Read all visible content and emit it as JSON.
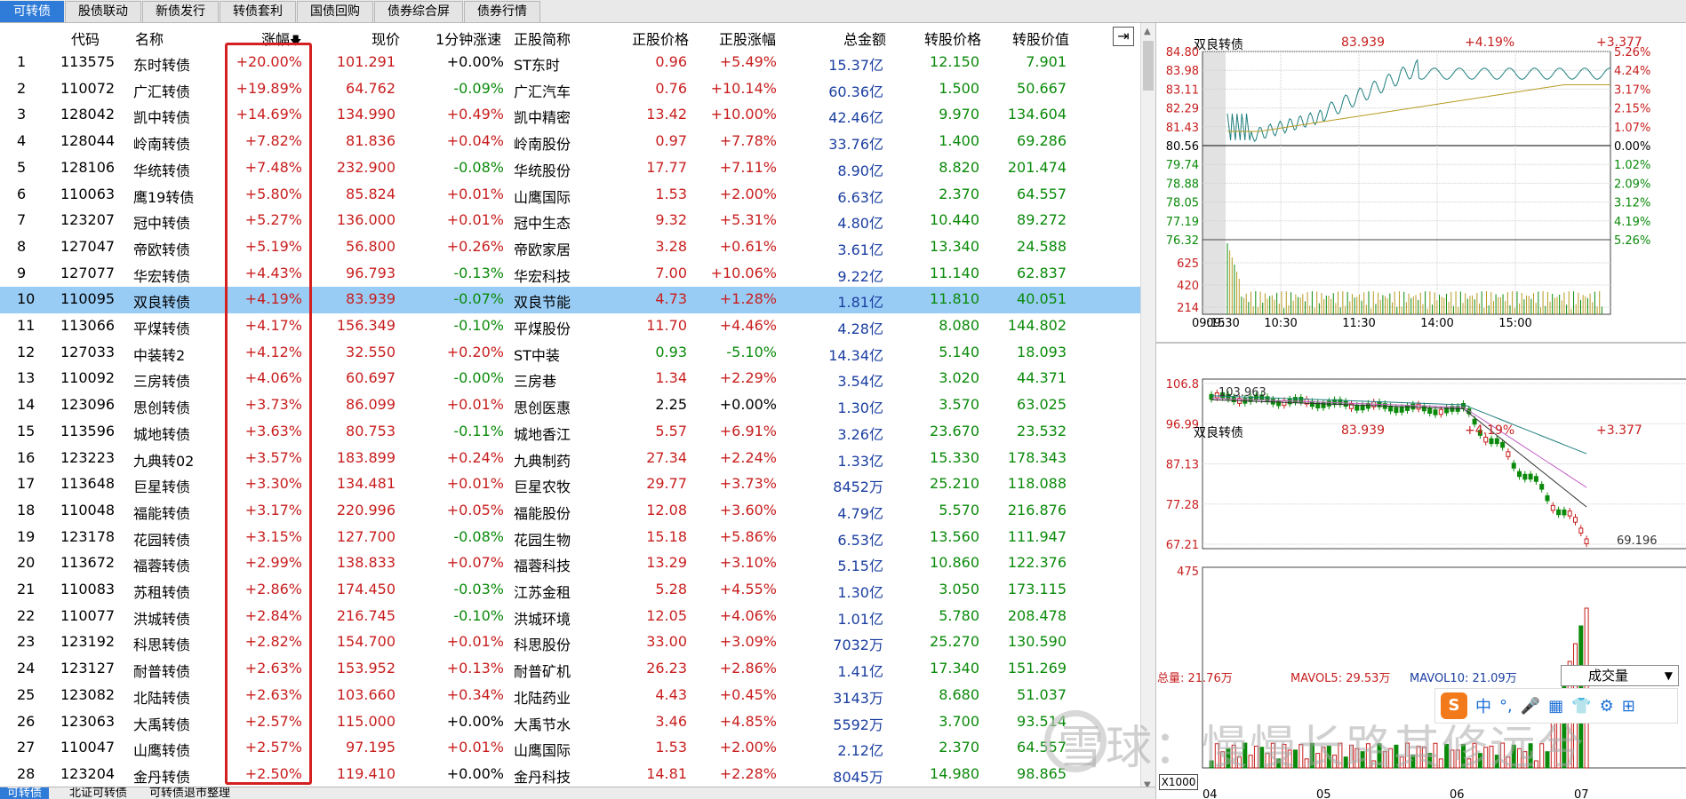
{
  "top_tabs": [
    "可转债",
    "股债联动",
    "新债发行",
    "转债套利",
    "国债回购",
    "债券综合屏",
    "债券行情"
  ],
  "headers": {
    "code": "代码",
    "name": "名称",
    "change": "涨幅",
    "price": "现价",
    "speed": "1分钟涨速",
    "stock_name": "正股简称",
    "stock_price": "正股价格",
    "stock_change": "正股涨幅",
    "total": "总金额",
    "conv_price": "转股价格",
    "conv_value": "转股价值"
  },
  "rows": [
    {
      "idx": "1",
      "code": "113575",
      "name": "东时转债",
      "change": "+20.00%",
      "price": "101.291",
      "speed": "+0.00%",
      "stock": "ST东时",
      "sp": "0.96",
      "sc": "+5.49%",
      "total": "15.37亿",
      "cp": "12.150",
      "cv": "7.901",
      "sp_color": "red",
      "speed_color": "black"
    },
    {
      "idx": "2",
      "code": "110072",
      "name": "广汇转债",
      "change": "+19.89%",
      "price": "64.762",
      "speed": "-0.09%",
      "stock": "广汇汽车",
      "sp": "0.76",
      "sc": "+10.14%",
      "total": "60.36亿",
      "cp": "1.500",
      "cv": "50.667",
      "sp_color": "red",
      "speed_color": "green"
    },
    {
      "idx": "3",
      "code": "128042",
      "name": "凯中转债",
      "change": "+14.69%",
      "price": "134.990",
      "speed": "+0.49%",
      "stock": "凯中精密",
      "sp": "13.42",
      "sc": "+10.00%",
      "total": "42.46亿",
      "cp": "9.970",
      "cv": "134.604",
      "sp_color": "red",
      "speed_color": "red"
    },
    {
      "idx": "4",
      "code": "128044",
      "name": "岭南转债",
      "change": "+7.82%",
      "price": "81.836",
      "speed": "+0.04%",
      "stock": "岭南股份",
      "sp": "0.97",
      "sc": "+7.78%",
      "total": "33.76亿",
      "cp": "1.400",
      "cv": "69.286",
      "sp_color": "red",
      "speed_color": "red"
    },
    {
      "idx": "5",
      "code": "128106",
      "name": "华统转债",
      "change": "+7.48%",
      "price": "232.900",
      "speed": "-0.08%",
      "stock": "华统股份",
      "sp": "17.77",
      "sc": "+7.11%",
      "total": "8.90亿",
      "cp": "8.820",
      "cv": "201.474",
      "sp_color": "red",
      "speed_color": "green"
    },
    {
      "idx": "6",
      "code": "110063",
      "name": "鹰19转债",
      "change": "+5.80%",
      "price": "85.824",
      "speed": "+0.01%",
      "stock": "山鹰国际",
      "sp": "1.53",
      "sc": "+2.00%",
      "total": "6.63亿",
      "cp": "2.370",
      "cv": "64.557",
      "sp_color": "red",
      "speed_color": "red"
    },
    {
      "idx": "7",
      "code": "123207",
      "name": "冠中转债",
      "change": "+5.27%",
      "price": "136.000",
      "speed": "+0.01%",
      "stock": "冠中生态",
      "sp": "9.32",
      "sc": "+5.31%",
      "total": "4.80亿",
      "cp": "10.440",
      "cv": "89.272",
      "sp_color": "red",
      "speed_color": "red"
    },
    {
      "idx": "8",
      "code": "127047",
      "name": "帝欧转债",
      "change": "+5.19%",
      "price": "56.800",
      "speed": "+0.26%",
      "stock": "帝欧家居",
      "sp": "3.28",
      "sc": "+0.61%",
      "total": "3.61亿",
      "cp": "13.340",
      "cv": "24.588",
      "sp_color": "red",
      "speed_color": "red"
    },
    {
      "idx": "9",
      "code": "127077",
      "name": "华宏转债",
      "change": "+4.43%",
      "price": "96.793",
      "speed": "-0.13%",
      "stock": "华宏科技",
      "sp": "7.00",
      "sc": "+10.06%",
      "total": "9.22亿",
      "cp": "11.140",
      "cv": "62.837",
      "sp_color": "red",
      "speed_color": "green"
    },
    {
      "idx": "10",
      "code": "110095",
      "name": "双良转债",
      "change": "+4.19%",
      "price": "83.939",
      "speed": "-0.07%",
      "stock": "双良节能",
      "sp": "4.73",
      "sc": "+1.28%",
      "total": "1.81亿",
      "cp": "11.810",
      "cv": "40.051",
      "sp_color": "red",
      "speed_color": "green",
      "selected": true
    },
    {
      "idx": "11",
      "code": "113066",
      "name": "平煤转债",
      "change": "+4.17%",
      "price": "156.349",
      "speed": "-0.10%",
      "stock": "平煤股份",
      "sp": "11.70",
      "sc": "+4.46%",
      "total": "4.28亿",
      "cp": "8.080",
      "cv": "144.802",
      "sp_color": "red",
      "speed_color": "green"
    },
    {
      "idx": "12",
      "code": "127033",
      "name": "中装转2",
      "change": "+4.12%",
      "price": "32.550",
      "speed": "+0.20%",
      "stock": "ST中装",
      "sp": "0.93",
      "sc": "-5.10%",
      "total": "14.34亿",
      "cp": "5.140",
      "cv": "18.093",
      "sp_color": "green",
      "speed_color": "red"
    },
    {
      "idx": "13",
      "code": "110092",
      "name": "三房转债",
      "change": "+4.06%",
      "price": "60.697",
      "speed": "-0.00%",
      "stock": "三房巷",
      "sp": "1.34",
      "sc": "+2.29%",
      "total": "3.54亿",
      "cp": "3.020",
      "cv": "44.371",
      "sp_color": "red",
      "speed_color": "green"
    },
    {
      "idx": "14",
      "code": "123096",
      "name": "思创转债",
      "change": "+3.73%",
      "price": "86.099",
      "speed": "+0.01%",
      "stock": "思创医惠",
      "sp": "2.25",
      "sc": "+0.00%",
      "total": "1.30亿",
      "cp": "3.570",
      "cv": "63.025",
      "sp_color": "black",
      "speed_color": "red"
    },
    {
      "idx": "15",
      "code": "113596",
      "name": "城地转债",
      "change": "+3.63%",
      "price": "80.753",
      "speed": "-0.11%",
      "stock": "城地香江",
      "sp": "5.57",
      "sc": "+6.91%",
      "total": "3.26亿",
      "cp": "23.670",
      "cv": "23.532",
      "sp_color": "red",
      "speed_color": "green"
    },
    {
      "idx": "16",
      "code": "123223",
      "name": "九典转02",
      "change": "+3.57%",
      "price": "183.899",
      "speed": "+0.24%",
      "stock": "九典制药",
      "sp": "27.34",
      "sc": "+2.24%",
      "total": "1.33亿",
      "cp": "15.330",
      "cv": "178.343",
      "sp_color": "red",
      "speed_color": "red"
    },
    {
      "idx": "17",
      "code": "113648",
      "name": "巨星转债",
      "change": "+3.30%",
      "price": "134.481",
      "speed": "+0.01%",
      "stock": "巨星农牧",
      "sp": "29.77",
      "sc": "+3.73%",
      "total": "8452万",
      "cp": "25.210",
      "cv": "118.088",
      "sp_color": "red",
      "speed_color": "red"
    },
    {
      "idx": "18",
      "code": "110048",
      "name": "福能转债",
      "change": "+3.17%",
      "price": "220.996",
      "speed": "+0.05%",
      "stock": "福能股份",
      "sp": "12.08",
      "sc": "+3.60%",
      "total": "4.79亿",
      "cp": "5.570",
      "cv": "216.876",
      "sp_color": "red",
      "speed_color": "red"
    },
    {
      "idx": "19",
      "code": "123178",
      "name": "花园转债",
      "change": "+3.15%",
      "price": "127.700",
      "speed": "-0.08%",
      "stock": "花园生物",
      "sp": "15.18",
      "sc": "+5.86%",
      "total": "6.53亿",
      "cp": "13.560",
      "cv": "111.947",
      "sp_color": "red",
      "speed_color": "green"
    },
    {
      "idx": "20",
      "code": "113672",
      "name": "福蓉转债",
      "change": "+2.99%",
      "price": "138.833",
      "speed": "+0.07%",
      "stock": "福蓉科技",
      "sp": "13.29",
      "sc": "+3.10%",
      "total": "5.15亿",
      "cp": "10.860",
      "cv": "122.376",
      "sp_color": "red",
      "speed_color": "red"
    },
    {
      "idx": "21",
      "code": "110083",
      "name": "苏租转债",
      "change": "+2.86%",
      "price": "174.450",
      "speed": "-0.03%",
      "stock": "江苏金租",
      "sp": "5.28",
      "sc": "+4.55%",
      "total": "1.30亿",
      "cp": "3.050",
      "cv": "173.115",
      "sp_color": "red",
      "speed_color": "green"
    },
    {
      "idx": "22",
      "code": "110077",
      "name": "洪城转债",
      "change": "+2.84%",
      "price": "216.745",
      "speed": "-0.10%",
      "stock": "洪城环境",
      "sp": "12.05",
      "sc": "+4.06%",
      "total": "1.01亿",
      "cp": "5.780",
      "cv": "208.478",
      "sp_color": "red",
      "speed_color": "green"
    },
    {
      "idx": "23",
      "code": "123192",
      "name": "科思转债",
      "change": "+2.82%",
      "price": "154.700",
      "speed": "+0.01%",
      "stock": "科思股份",
      "sp": "33.00",
      "sc": "+3.09%",
      "total": "7032万",
      "cp": "25.270",
      "cv": "130.590",
      "sp_color": "red",
      "speed_color": "red"
    },
    {
      "idx": "24",
      "code": "123127",
      "name": "耐普转债",
      "change": "+2.63%",
      "price": "153.952",
      "speed": "+0.13%",
      "stock": "耐普矿机",
      "sp": "26.23",
      "sc": "+2.86%",
      "total": "1.41亿",
      "cp": "17.340",
      "cv": "151.269",
      "sp_color": "red",
      "speed_color": "red"
    },
    {
      "idx": "25",
      "code": "123082",
      "name": "北陆转债",
      "change": "+2.63%",
      "price": "103.660",
      "speed": "+0.34%",
      "stock": "北陆药业",
      "sp": "4.43",
      "sc": "+0.45%",
      "total": "3143万",
      "cp": "8.680",
      "cv": "51.037",
      "sp_color": "red",
      "speed_color": "red"
    },
    {
      "idx": "26",
      "code": "123063",
      "name": "大禹转债",
      "change": "+2.57%",
      "price": "115.000",
      "speed": "+0.00%",
      "stock": "大禹节水",
      "sp": "3.46",
      "sc": "+4.85%",
      "total": "5592万",
      "cp": "3.700",
      "cv": "93.514",
      "sp_color": "red",
      "speed_color": "black"
    },
    {
      "idx": "27",
      "code": "110047",
      "name": "山鹰转债",
      "change": "+2.57%",
      "price": "97.195",
      "speed": "+0.01%",
      "stock": "山鹰国际",
      "sp": "1.53",
      "sc": "+2.00%",
      "total": "2.12亿",
      "cp": "2.370",
      "cv": "64.557",
      "sp_color": "red",
      "speed_color": "red"
    },
    {
      "idx": "28",
      "code": "123204",
      "name": "金丹转债",
      "change": "+2.50%",
      "price": "119.410",
      "speed": "+0.00%",
      "stock": "金丹科技",
      "sp": "14.81",
      "sc": "+2.28%",
      "total": "8045万",
      "cp": "14.980",
      "cv": "98.865",
      "sp_color": "red",
      "speed_color": "black"
    }
  ],
  "bottom_tabs": [
    "可转债",
    "北证可转债",
    "可转债退市整理"
  ],
  "intraday": {
    "name": "双良转债",
    "price": "83.939",
    "pct": "+4.19%",
    "chg": "+3.377",
    "left_axis": [
      "84.80",
      "83.98",
      "83.11",
      "82.29",
      "81.43",
      "80.56",
      "79.74",
      "78.88",
      "78.05",
      "77.19",
      "76.32"
    ],
    "right_axis": [
      "5.26%",
      "4.24%",
      "3.17%",
      "2.15%",
      "1.07%",
      "0.00%",
      "1.02%",
      "2.09%",
      "3.12%",
      "4.19%",
      "5.26%"
    ],
    "vol_axis": [
      "625",
      "420",
      "214"
    ],
    "time_axis": [
      "09:15",
      "09:30",
      "10:30",
      "11:30",
      "14:00",
      "15:00"
    ]
  },
  "daily": {
    "name": "双良转债",
    "price": "83.939",
    "pct": "+4.19%",
    "chg": "+3.377",
    "y_axis": [
      "106.8",
      "96.99",
      "87.13",
      "77.28",
      "67.21"
    ],
    "high_mark": "103.963",
    "low_mark": "69.196",
    "vol_label": "总量: 21.76万",
    "mavol5": "MAVOL5: 29.53万",
    "mavol10": "MAVOL10: 21.09万",
    "vol_axis_top": "475",
    "vol_select": "成交量",
    "multiplier": "X1000",
    "date_axis": [
      "04",
      "05",
      "06",
      "07"
    ]
  },
  "toolbar": {
    "logo": "S",
    "items": [
      "中",
      "°,",
      "🎤",
      "▦",
      "👕",
      "⚙",
      "⊞"
    ]
  },
  "watermark": "雪球：慢慢长路其修远兮",
  "colors": {
    "up": "#c81e1e",
    "down": "#0a8a0a",
    "selected_row": "#99ccf5",
    "active_tab": "#2f7bd8"
  }
}
